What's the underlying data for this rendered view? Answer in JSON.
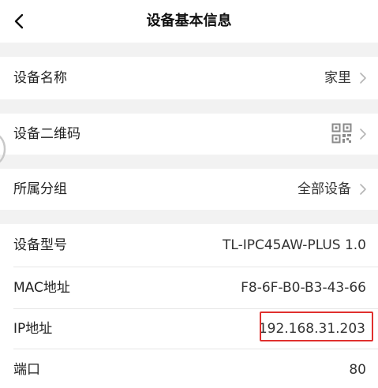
{
  "header": {
    "title": "设备基本信息"
  },
  "rows": {
    "device_name": {
      "label": "设备名称",
      "value": "家里"
    },
    "device_qrcode": {
      "label": "设备二维码"
    },
    "group": {
      "label": "所属分组",
      "value": "全部设备"
    },
    "model": {
      "label": "设备型号",
      "value": "TL-IPC45AW-PLUS 1.0"
    },
    "mac": {
      "label": "MAC地址",
      "value": "F8-6F-B0-B3-43-66"
    },
    "ip": {
      "label": "IP地址",
      "value": "192.168.31.203"
    },
    "port": {
      "label": "端口",
      "value": "80"
    }
  },
  "colors": {
    "highlight": "#e0302e",
    "section_gap": "#f2f2f2"
  },
  "icons": {
    "back": "chevron-left-icon",
    "chevron": "chevron-right-icon",
    "qrcode": "qr-code-icon"
  }
}
